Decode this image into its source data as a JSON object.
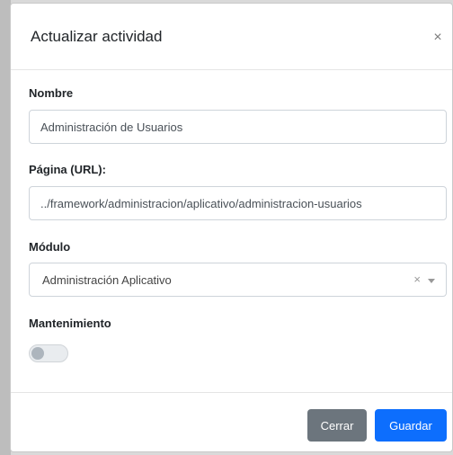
{
  "modal": {
    "title": "Actualizar actividad",
    "close_icon": "close-icon",
    "close_glyph": "×"
  },
  "form": {
    "nombre": {
      "label": "Nombre",
      "value": "Administración de Usuarios"
    },
    "pagina": {
      "label": "Página (URL):",
      "value": "../framework/administracion/aplicativo/administracion-usuarios"
    },
    "modulo": {
      "label": "Módulo",
      "selected": "Administración Aplicativo",
      "clear_glyph": "×",
      "arrow_icon": "chevron-down-icon"
    },
    "mantenimiento": {
      "label": "Mantenimiento",
      "enabled": false
    }
  },
  "footer": {
    "cancel_label": "Cerrar",
    "save_label": "Guardar"
  },
  "colors": {
    "primary": "#0d6efd",
    "secondary": "#6c757d"
  }
}
